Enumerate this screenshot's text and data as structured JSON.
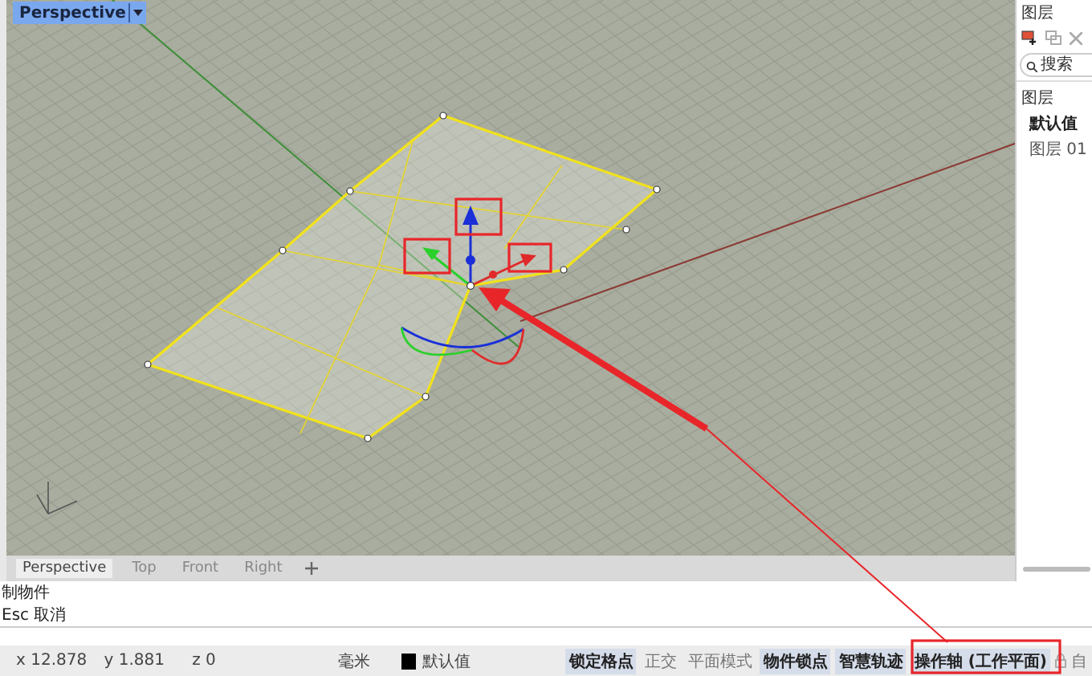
{
  "viewport": {
    "title": "Perspective"
  },
  "viewport_tabs": [
    {
      "label": "Perspective",
      "selected": true
    },
    {
      "label": "Top",
      "selected": false
    },
    {
      "label": "Front",
      "selected": false
    },
    {
      "label": "Right",
      "selected": false
    }
  ],
  "layers_panel": {
    "title": "图层",
    "search": {
      "placeholder": "搜索"
    },
    "header": "图层",
    "layers": [
      {
        "name": "默认值",
        "current": true
      },
      {
        "name": "图层 01",
        "current": false
      }
    ]
  },
  "command_history": [
    "制物件",
    "Esc 取消"
  ],
  "status_bar": {
    "x": "x 12.878",
    "y": "y 1.881",
    "z": "z 0",
    "units": "毫米",
    "layer": {
      "name": "默认值",
      "color": "#000000"
    },
    "toggles": [
      {
        "label": "锁定格点",
        "on": true
      },
      {
        "label": "正交",
        "on": false
      },
      {
        "label": "平面模式",
        "on": false
      },
      {
        "label": "物件锁点",
        "on": true
      },
      {
        "label": "智慧轨迹",
        "on": true
      },
      {
        "label": "操作轴 (工作平面)",
        "on": true
      }
    ],
    "auto_label": "自"
  }
}
